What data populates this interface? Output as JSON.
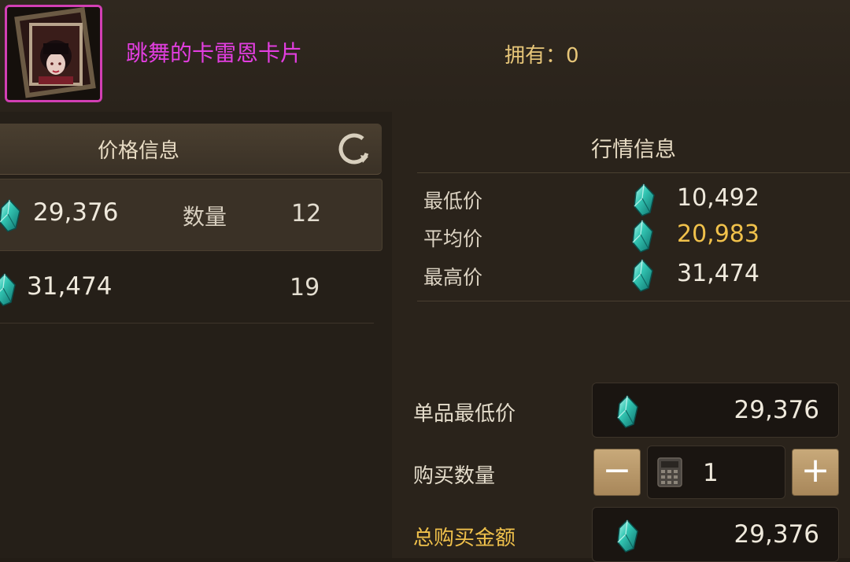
{
  "item": {
    "name": "跳舞的卡雷恩卡片",
    "owned_label": "拥有：0"
  },
  "price_info": {
    "title": "价格信息",
    "rows": [
      {
        "price": "29,376",
        "qty_label": "数量",
        "qty": "12",
        "selected": true
      },
      {
        "price": "31,474",
        "qty": "19",
        "selected": false
      }
    ]
  },
  "market_info": {
    "title": "行情信息",
    "rows": [
      {
        "label": "最低价",
        "value": "10,492"
      },
      {
        "label": "平均价",
        "value": "20,983"
      },
      {
        "label": "最高价",
        "value": "31,474"
      }
    ]
  },
  "purchase": {
    "unit_price_label": "单品最低价",
    "unit_price": "29,376",
    "quantity_label": "购买数量",
    "quantity": "1",
    "minus": "−",
    "plus": "+",
    "total_label": "总购买金额",
    "total": "29,376"
  },
  "colors": {
    "accent_gold": "#f0c14b",
    "item_name": "#e23ee0",
    "owned": "#e7c679"
  },
  "icons": [
    "item-card-icon",
    "refresh-icon",
    "gem-icon",
    "calculator-icon"
  ]
}
